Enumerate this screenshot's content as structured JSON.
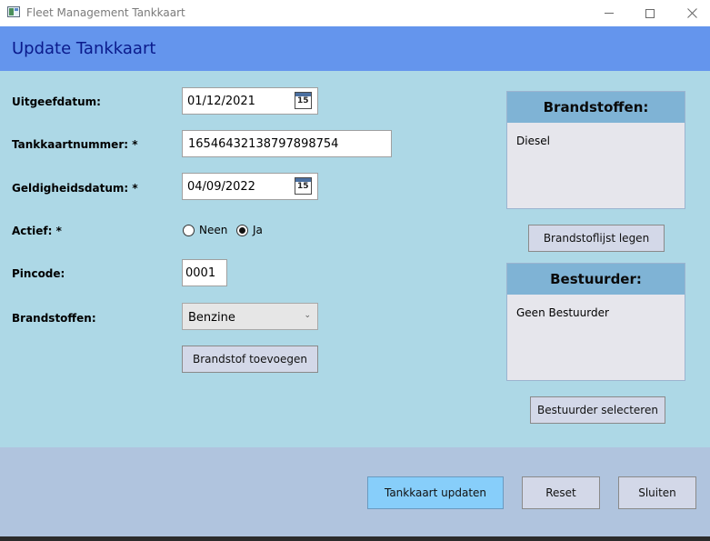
{
  "window": {
    "title": "Fleet Management Tankkaart",
    "app_icon": "app-window-icon",
    "controls": [
      "minimize-icon",
      "maximize-icon",
      "close-icon"
    ]
  },
  "header": {
    "title": "Update Tankkaart"
  },
  "form": {
    "uitgeefdatum": {
      "label": "Uitgeefdatum:",
      "value": "01/12/2021",
      "icon_text": "15"
    },
    "tankkaartnummer": {
      "label": "Tankkaartnummer: *",
      "value": "16546432138797898754"
    },
    "geldigheidsdatum": {
      "label": "Geldigheidsdatum: *",
      "value": "04/09/2022",
      "icon_text": "15"
    },
    "actief": {
      "label": "Actief: *",
      "options": [
        {
          "label": "Neen",
          "checked": false
        },
        {
          "label": "Ja",
          "checked": true
        }
      ]
    },
    "pincode": {
      "label": "Pincode:",
      "value": "0001"
    },
    "brandstoffen": {
      "label": "Brandstoffen:",
      "selected": "Benzine"
    },
    "add_button": "Brandstof toevoegen"
  },
  "brandstoffen_panel": {
    "title": "Brandstoffen:",
    "items": [
      "Diesel"
    ],
    "clear_button": "Brandstoflijst legen"
  },
  "bestuurder_panel": {
    "title": "Bestuurder:",
    "value": "Geen Bestuurder",
    "select_button": "Bestuurder selecteren"
  },
  "footer": {
    "update_button": "Tankkaart updaten",
    "reset_button": "Reset",
    "close_button": "Sluiten"
  },
  "colors": {
    "header_bg": "#6495ed",
    "form_bg": "#add8e6",
    "footer_bg": "#b0c4de",
    "primary_button": "#87cefa",
    "panel_header": "#7fb3d5"
  }
}
